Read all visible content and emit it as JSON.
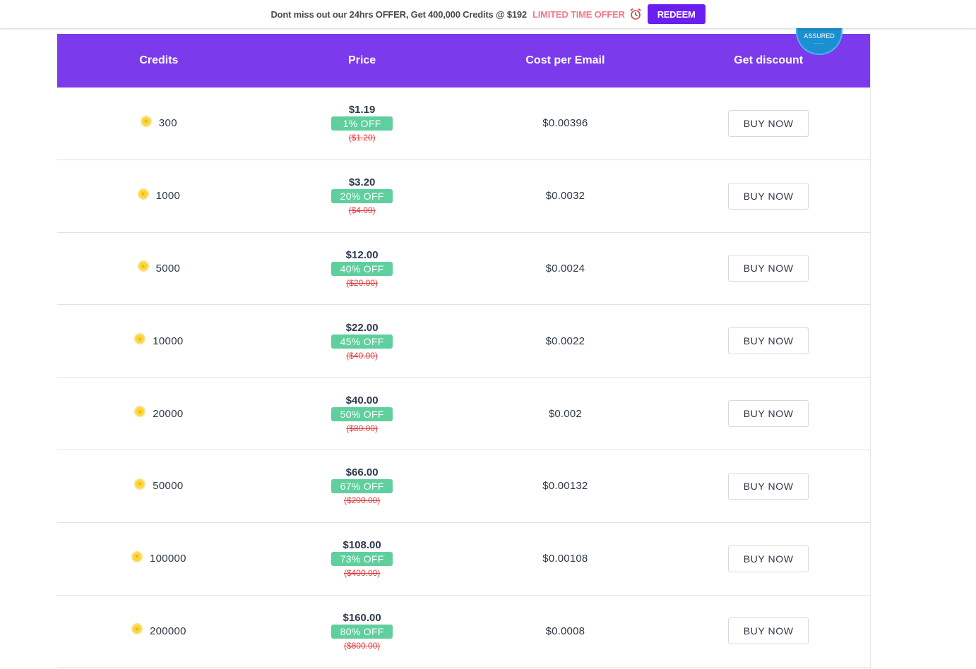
{
  "offer_bar": {
    "text": "Dont miss out our 24hrs OFFER, Get 400,000 Credits @ $192",
    "limited": "LIMITED TIME OFFER",
    "clock_icon": "alarm-clock-icon",
    "redeem_label": "REDEEM"
  },
  "table": {
    "headers": [
      "Credits",
      "Price",
      "Cost per Email",
      "Get discount"
    ],
    "badge": {
      "text": "ASSURED"
    },
    "rows": [
      {
        "credits": "300",
        "price": "$1.19",
        "off": "1% OFF",
        "original": "($1.20)",
        "cpe": "$0.00396",
        "buy": "BUY NOW"
      },
      {
        "credits": "1000",
        "price": "$3.20",
        "off": "20% OFF",
        "original": "($4.00)",
        "cpe": "$0.0032",
        "buy": "BUY NOW"
      },
      {
        "credits": "5000",
        "price": "$12.00",
        "off": "40% OFF",
        "original": "($20.00)",
        "cpe": "$0.0024",
        "buy": "BUY NOW"
      },
      {
        "credits": "10000",
        "price": "$22.00",
        "off": "45% OFF",
        "original": "($40.00)",
        "cpe": "$0.0022",
        "buy": "BUY NOW"
      },
      {
        "credits": "20000",
        "price": "$40.00",
        "off": "50% OFF",
        "original": "($80.00)",
        "cpe": "$0.002",
        "buy": "BUY NOW"
      },
      {
        "credits": "50000",
        "price": "$66.00",
        "off": "67% OFF",
        "original": "($200.00)",
        "cpe": "$0.00132",
        "buy": "BUY NOW"
      },
      {
        "credits": "100000",
        "price": "$108.00",
        "off": "73% OFF",
        "original": "($400.00)",
        "cpe": "$0.00108",
        "buy": "BUY NOW"
      },
      {
        "credits": "200000",
        "price": "$160.00",
        "off": "80% OFF",
        "original": "($800.00)",
        "cpe": "$0.0008",
        "buy": "BUY NOW"
      }
    ]
  },
  "colors": {
    "header_bg": "#7c3aed",
    "redeem_bg": "#6a1ff0",
    "discount_badge": "#5fcf9e",
    "limited_text": "#f07b86",
    "original_price": "#e03c3c",
    "coin": "#fcd53f"
  }
}
